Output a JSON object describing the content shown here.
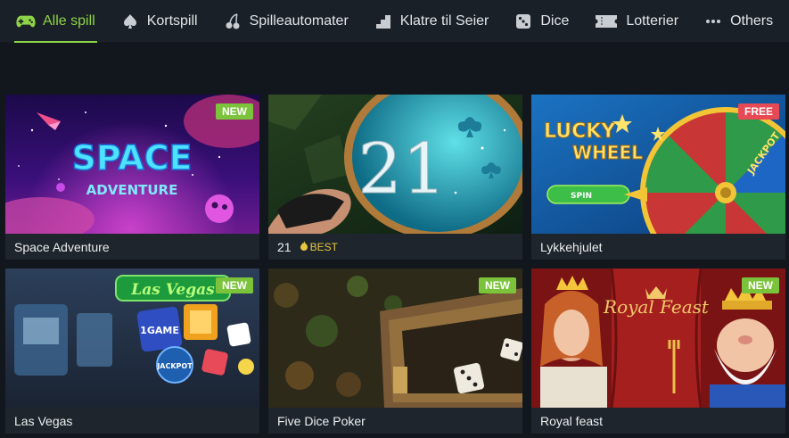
{
  "nav": {
    "tabs": [
      {
        "label": "Alle spill",
        "icon": "gamepad-icon",
        "active": true
      },
      {
        "label": "Kortspill",
        "icon": "spade-icon",
        "active": false
      },
      {
        "label": "Spilleautomater",
        "icon": "cherries-icon",
        "active": false
      },
      {
        "label": "Klatre til Seier",
        "icon": "steps-icon",
        "active": false
      },
      {
        "label": "Dice",
        "icon": "dice-icon",
        "active": false
      },
      {
        "label": "Lotterier",
        "icon": "ticket-icon",
        "active": false
      },
      {
        "label": "Others",
        "icon": "more-dots-icon",
        "active": false
      }
    ]
  },
  "colors": {
    "accent": "#8dd347",
    "badge_new": "#7cc33c",
    "badge_free": "#e74a55",
    "best": "#e8c640"
  },
  "games": [
    {
      "title": "Space Adventure",
      "badge": "NEW",
      "art_text": [
        "SPACE",
        "ADVENTURE"
      ]
    },
    {
      "title": "21",
      "tag": "BEST",
      "art_text": [
        "21"
      ]
    },
    {
      "title": "Lykkehjulet",
      "badge": "FREE",
      "art_text": [
        "LUCKY",
        "WHEEL",
        "SPIN",
        "JACKPOT"
      ]
    },
    {
      "title": "Las Vegas",
      "badge": "NEW",
      "art_text": [
        "Las Vegas",
        "1GAME",
        "JACKPOT"
      ]
    },
    {
      "title": "Five Dice Poker",
      "badge": "NEW"
    },
    {
      "title": "Royal feast",
      "badge": "NEW",
      "art_text": [
        "Royal Feast"
      ]
    }
  ]
}
